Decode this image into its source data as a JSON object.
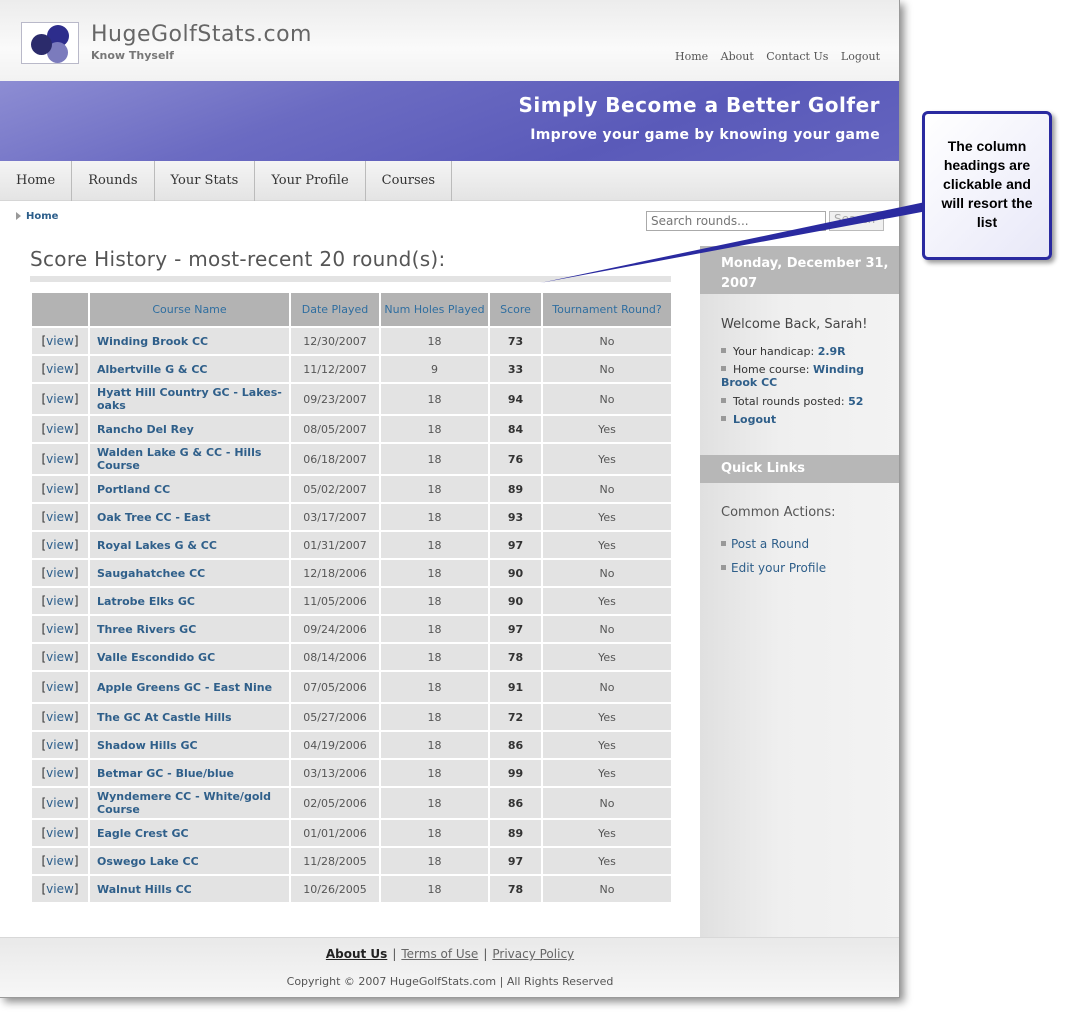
{
  "header": {
    "site_name": "HugeGolfStats.com",
    "tagline": "Know Thyself",
    "top_links": [
      "Home",
      "About",
      "Contact Us",
      "Logout"
    ]
  },
  "banner": {
    "title": "Simply Become a Better Golfer",
    "subtitle": "Improve your game by knowing your game"
  },
  "nav": {
    "tabs": [
      "Home",
      "Rounds",
      "Your Stats",
      "Your Profile",
      "Courses"
    ]
  },
  "breadcrumb": {
    "home": "Home"
  },
  "search": {
    "placeholder": "Search rounds...",
    "button": "Search"
  },
  "main": {
    "title": "Score History - most-recent 20 round(s):",
    "columns": {
      "view": "",
      "course": "Course Name",
      "date": "Date Played",
      "holes": "Num Holes Played",
      "score": "Score",
      "tournament": "Tournament Round?"
    },
    "view_label": "view",
    "rows": [
      {
        "course": "Winding Brook CC",
        "date": "12/30/2007",
        "holes": "18",
        "score": "73",
        "tournament": "No"
      },
      {
        "course": "Albertville G & CC",
        "date": "11/12/2007",
        "holes": "9",
        "score": "33",
        "tournament": "No"
      },
      {
        "course": "Hyatt Hill Country GC - Lakes-oaks",
        "date": "09/23/2007",
        "holes": "18",
        "score": "94",
        "tournament": "No"
      },
      {
        "course": "Rancho Del Rey",
        "date": "08/05/2007",
        "holes": "18",
        "score": "84",
        "tournament": "Yes"
      },
      {
        "course": "Walden Lake G & CC - Hills Course",
        "date": "06/18/2007",
        "holes": "18",
        "score": "76",
        "tournament": "Yes"
      },
      {
        "course": "Portland CC",
        "date": "05/02/2007",
        "holes": "18",
        "score": "89",
        "tournament": "No"
      },
      {
        "course": "Oak Tree CC - East",
        "date": "03/17/2007",
        "holes": "18",
        "score": "93",
        "tournament": "Yes"
      },
      {
        "course": "Royal Lakes G & CC",
        "date": "01/31/2007",
        "holes": "18",
        "score": "97",
        "tournament": "Yes"
      },
      {
        "course": "Saugahatchee CC",
        "date": "12/18/2006",
        "holes": "18",
        "score": "90",
        "tournament": "No"
      },
      {
        "course": "Latrobe Elks GC",
        "date": "11/05/2006",
        "holes": "18",
        "score": "90",
        "tournament": "Yes"
      },
      {
        "course": "Three Rivers GC",
        "date": "09/24/2006",
        "holes": "18",
        "score": "97",
        "tournament": "No"
      },
      {
        "course": "Valle Escondido GC",
        "date": "08/14/2006",
        "holes": "18",
        "score": "78",
        "tournament": "Yes"
      },
      {
        "course": "Apple Greens GC - East Nine",
        "date": "07/05/2006",
        "holes": "18",
        "score": "91",
        "tournament": "No"
      },
      {
        "course": "The GC At Castle Hills",
        "date": "05/27/2006",
        "holes": "18",
        "score": "72",
        "tournament": "Yes"
      },
      {
        "course": "Shadow Hills GC",
        "date": "04/19/2006",
        "holes": "18",
        "score": "86",
        "tournament": "Yes"
      },
      {
        "course": "Betmar GC - Blue/blue",
        "date": "03/13/2006",
        "holes": "18",
        "score": "99",
        "tournament": "Yes"
      },
      {
        "course": "Wyndemere CC - White/gold Course",
        "date": "02/05/2006",
        "holes": "18",
        "score": "86",
        "tournament": "No"
      },
      {
        "course": "Eagle Crest GC",
        "date": "01/01/2006",
        "holes": "18",
        "score": "89",
        "tournament": "Yes"
      },
      {
        "course": "Oswego Lake CC",
        "date": "11/28/2005",
        "holes": "18",
        "score": "97",
        "tournament": "Yes"
      },
      {
        "course": "Walnut Hills CC",
        "date": "10/26/2005",
        "holes": "18",
        "score": "78",
        "tournament": "No"
      }
    ]
  },
  "sidebar": {
    "date": "Monday, December 31, 2007",
    "welcome": "Welcome Back, Sarah!",
    "handicap_label": "Your handicap:",
    "handicap_value": "2.9R",
    "home_course_label": "Home course:",
    "home_course_value": "Winding Brook CC",
    "total_rounds_label": "Total rounds posted:",
    "total_rounds_value": "52",
    "logout": "Logout",
    "quick_links_header": "Quick Links",
    "common_actions": "Common Actions:",
    "links": [
      "Post a Round",
      "Edit your Profile"
    ]
  },
  "footer": {
    "links": [
      "About Us",
      "Terms of Use",
      "Privacy Policy"
    ],
    "copyright": "Copyright © 2007 HugeGolfStats.com | All Rights Reserved"
  },
  "callout": {
    "text": "The column headings are clickable and will resort the list"
  },
  "colors": {
    "banner": "#6b6bc2",
    "link": "#2f5f8a",
    "table_header": "#b3b3b3",
    "table_cell": "#e3e3e3",
    "callout_border": "#2a2aa0"
  }
}
